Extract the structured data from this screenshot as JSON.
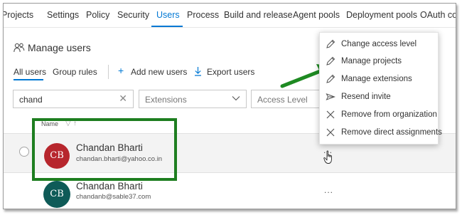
{
  "nav": {
    "tabs": [
      {
        "label": "Projects"
      },
      {
        "label": "Settings"
      },
      {
        "label": "Policy"
      },
      {
        "label": "Security"
      },
      {
        "label": "Users"
      },
      {
        "label": "Process"
      },
      {
        "label": "Build and release"
      },
      {
        "label": "Agent pools"
      },
      {
        "label": "Deployment pools"
      },
      {
        "label": "OAuth co"
      }
    ],
    "active_tab": "Users"
  },
  "page": {
    "title": "Manage users",
    "title_icon": "people-icon"
  },
  "subnav": {
    "tabs": [
      {
        "label": "All users"
      },
      {
        "label": "Group rules"
      }
    ],
    "active": "All users",
    "add_label": "Add new users",
    "export_label": "Export users"
  },
  "filters": {
    "search_value": "chand",
    "extensions_placeholder": "Extensions",
    "access_placeholder": "Access Level"
  },
  "table": {
    "name_header": "Name",
    "rows": [
      {
        "initials": "CB",
        "name": "Chandan Bharti",
        "email": "chandan.bharti@yahoo.co.in",
        "avatar_color": "#b7262d",
        "more": "..."
      },
      {
        "initials": "CB",
        "name": "Chandan Bharti",
        "email": "chandanb@sable37.com",
        "avatar_color": "#0f5b58",
        "more": "..."
      }
    ]
  },
  "context_menu": {
    "items": [
      {
        "label": "Change access level",
        "icon": "pencil-icon"
      },
      {
        "label": "Manage projects",
        "icon": "pencil-icon"
      },
      {
        "label": "Manage extensions",
        "icon": "pencil-icon"
      },
      {
        "label": "Resend invite",
        "icon": "send-icon"
      },
      {
        "label": "Remove from organization",
        "icon": "close-icon"
      },
      {
        "label": "Remove direct assignments",
        "icon": "close-icon"
      }
    ]
  },
  "colors": {
    "accent": "#0078d4",
    "highlight": "#1e7e20"
  }
}
